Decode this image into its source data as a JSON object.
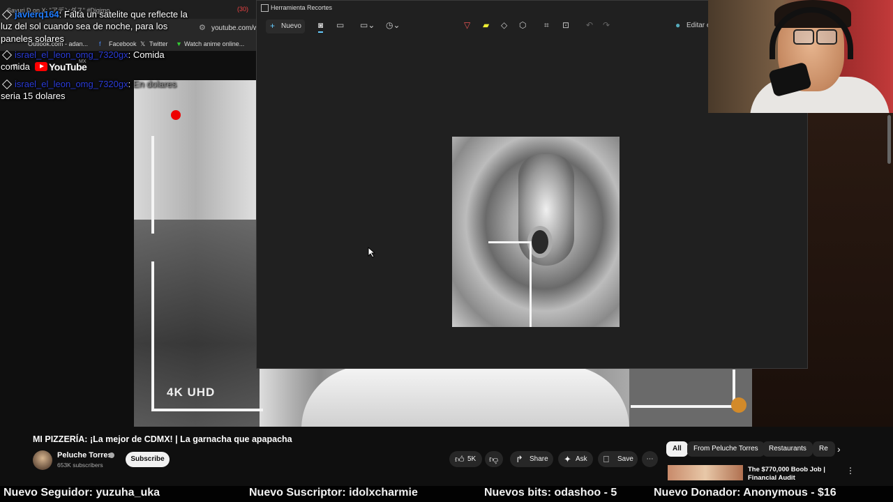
{
  "browser": {
    "tabs": [
      "Sayuri D on X: \"アデンダス\" #Digimo",
      "(30)",
      "(29) YouTube"
    ],
    "url": "youtube.com/w",
    "bookmarks": [
      "Outlook.com - adan...",
      "Facebook",
      "Twitter",
      "Watch anime online..."
    ]
  },
  "youtube": {
    "logo_text": "YouTube",
    "region": "MX"
  },
  "chat": [
    {
      "user": "javierq164",
      "text1": "Falta un satelite que reflecte la",
      "text2": "luz del sol cuando sea de noche, para los",
      "text3": "paneles solares"
    },
    {
      "user": "israel_el_leon_omg_7320gx",
      "text1": "Comida",
      "text2": "comida"
    },
    {
      "user": "israel_el_leon_omg_7320gx",
      "text1": "En dolares",
      "text2": "seria 15 dolares"
    }
  ],
  "video": {
    "badge": "4K UHD"
  },
  "snip": {
    "title": "Herramienta Recortes",
    "new_label": "Nuevo",
    "edit_label": "Editar e"
  },
  "below": {
    "title": "MI PIZZERÍA: ¡La mejor de CDMX! | La garnacha que apapacha",
    "channel": "Peluche Torres",
    "subscribers": "653K subscribers",
    "subscribe": "Subscribe",
    "likes": "5K",
    "share": "Share",
    "ask": "Ask",
    "save": "Save"
  },
  "chips": [
    "All",
    "From Peluche Torres",
    "Restaurants",
    "Re"
  ],
  "recommended": {
    "title": "The $770,000 Boob Job | Financial Audit"
  },
  "ticker": [
    "Nuevo Seguidor: yuzuha_uka",
    "Nuevo Suscriptor: idolxcharmie",
    "Nuevos bits: odashoo - 5",
    "Nuevo Donador: Anonymous - $16"
  ]
}
